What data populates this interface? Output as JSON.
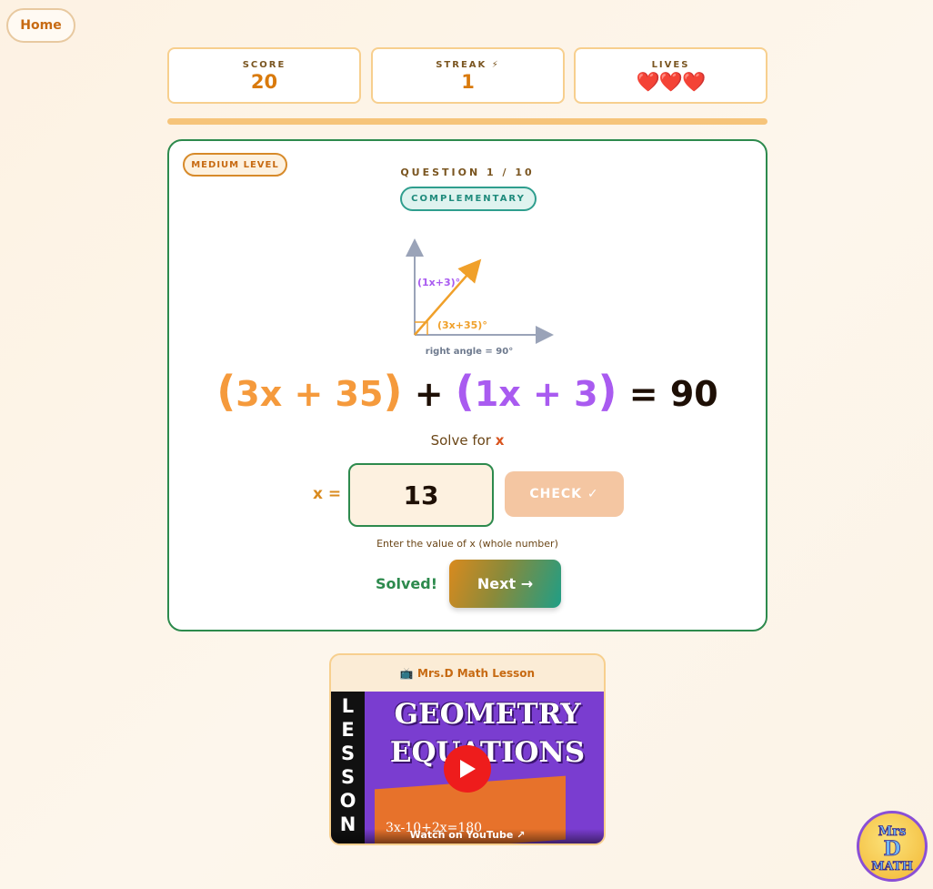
{
  "nav": {
    "home_label": "Home"
  },
  "stats": {
    "score_label": "SCORE",
    "score_value": "20",
    "streak_label": "STREAK ⚡",
    "streak_value": "1",
    "lives_label": "LIVES",
    "lives_value": "❤️❤️❤️"
  },
  "progress": {
    "fraction": 1.0
  },
  "question": {
    "level": "MEDIUM LEVEL",
    "number_label": "QUESTION 1 / 10",
    "type": "COMPLEMENTARY",
    "diagram": {
      "upper_angle_label": "(1x+3)°",
      "lower_angle_label": "(3x+35)°",
      "caption": "right angle = 90°"
    },
    "equation": {
      "term1_open": "(",
      "term1": "3x + 35",
      "term1_close": ")",
      "plus": "+",
      "term2_open": "(",
      "term2": "1x + 3",
      "term2_close": ")",
      "equals": "= 90"
    },
    "solve_prefix": "Solve for",
    "solve_var": "x",
    "input_label": "x =",
    "input_value": "13",
    "check_label": "CHECK ✓",
    "hint": "Enter the value of x (whole number)",
    "status": "Solved!",
    "next_label": "Next →"
  },
  "video": {
    "title": "📺 Mrs.D Math Lesson",
    "side_text": [
      "L",
      "E",
      "S",
      "S",
      "O",
      "N"
    ],
    "heading_line1": "GEOMETRY",
    "heading_line2": "EQUATIONS",
    "board_text": "3x-10+2x=180",
    "watch_label": "Watch on YouTube ↗"
  },
  "logo": {
    "line1": "Mrs",
    "line2": "D",
    "line3": "MATH"
  },
  "colors": {
    "accent_orange": "#d97a0c",
    "term_orange": "#f59a3c",
    "term_purple": "#a95bf0",
    "success_green": "#2d8a4d",
    "teal": "#1f9e86"
  }
}
